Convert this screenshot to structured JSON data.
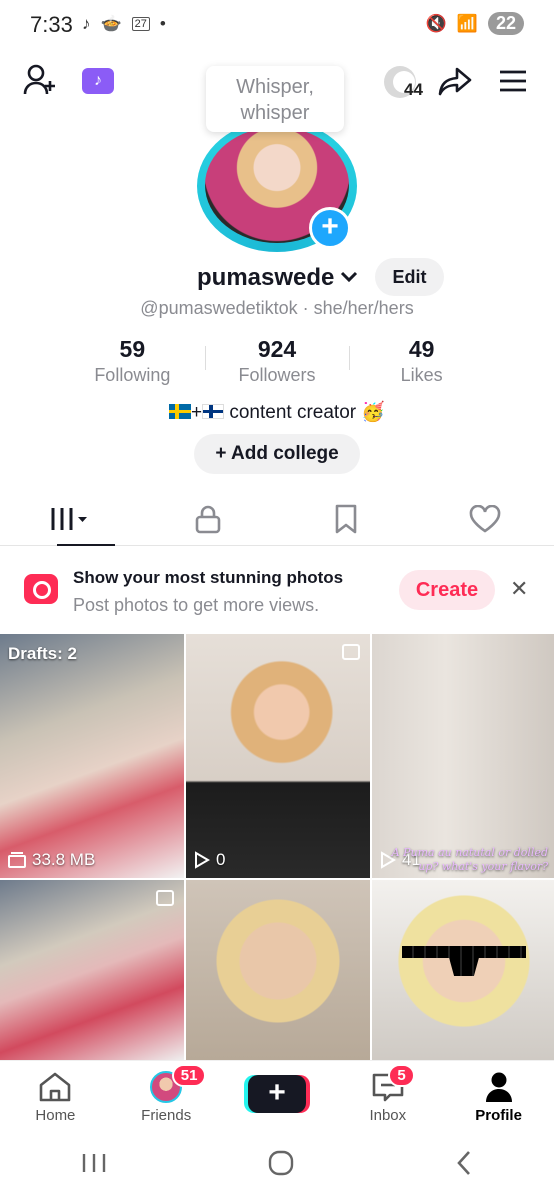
{
  "status_bar": {
    "time": "7:33",
    "notif_badge": "27",
    "battery": "22"
  },
  "top_bar": {
    "coin_count": "44",
    "whisper_text": "Whisper, whisper"
  },
  "profile": {
    "username": "pumaswede",
    "edit_label": "Edit",
    "handle": "@pumaswedetiktok · she/her/hers",
    "stats": [
      {
        "value": "59",
        "label": "Following"
      },
      {
        "value": "924",
        "label": "Followers"
      },
      {
        "value": "49",
        "label": "Likes"
      }
    ],
    "bio_text": "content creator",
    "bio_plus": "+",
    "bio_emoji": "🥳",
    "add_college_label": "Add college"
  },
  "banner": {
    "title": "Show your most stunning photos",
    "subtitle": "Post photos to get more views.",
    "create_label": "Create",
    "close_label": "✕"
  },
  "grid": [
    {
      "overlay_top": "Drafts: 2",
      "overlay_bottom": "33.8 MB"
    },
    {
      "overlay_bottom": "0"
    },
    {
      "overlay_bottom": "41",
      "caption": "A Puma au natutal or dolled up? what's your flavor?"
    },
    {},
    {},
    {}
  ],
  "bottom_nav": [
    {
      "label": "Home"
    },
    {
      "label": "Friends",
      "badge": "51"
    },
    {
      "label": "+"
    },
    {
      "label": "Inbox",
      "badge": "5"
    },
    {
      "label": "Profile"
    }
  ]
}
